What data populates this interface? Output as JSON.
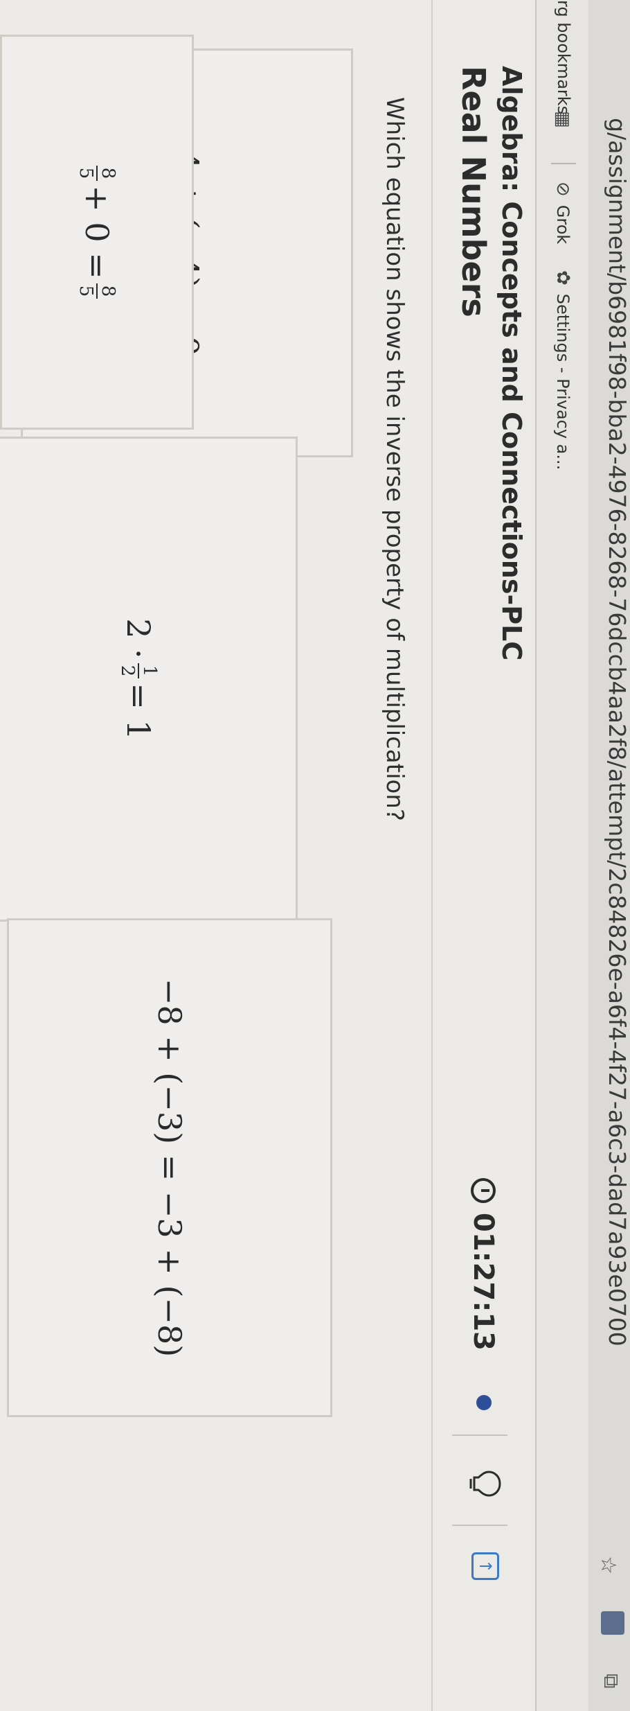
{
  "browser": {
    "url": "g/assignment/b6981f98-bba2-4976-8268-76dccb4aa2f8/attempt/2c84826e-a6f4-4f27-a6c3-dad7a93e0700",
    "bookmarks": [
      {
        "label": "rg bookmarks",
        "icon": "apps-icon"
      },
      {
        "label": "Grok",
        "icon": "grok-icon"
      },
      {
        "label": "Settings - Privacy a...",
        "icon": "gear-icon"
      }
    ]
  },
  "header": {
    "course": "Algebra: Concepts and Connections-PLC",
    "lesson": "Real Numbers",
    "timer": "01:27:13"
  },
  "question": {
    "prompt": "Which equation shows the inverse property of multiplication?",
    "options": {
      "a": {
        "left": "4 + (−4) = 0"
      },
      "b": {
        "pre": "2 ·",
        "num": "1",
        "den": "2",
        "post": "= 1"
      },
      "c": {
        "text": "−8 + (−3) = −3 + (−8)"
      },
      "d": {
        "num1": "8",
        "den1": "5",
        "mid": "+ 0 =",
        "num2": "8",
        "den2": "5"
      }
    }
  },
  "colors": {
    "accent": "#2d4f9a",
    "tool": "#3b79c9"
  }
}
